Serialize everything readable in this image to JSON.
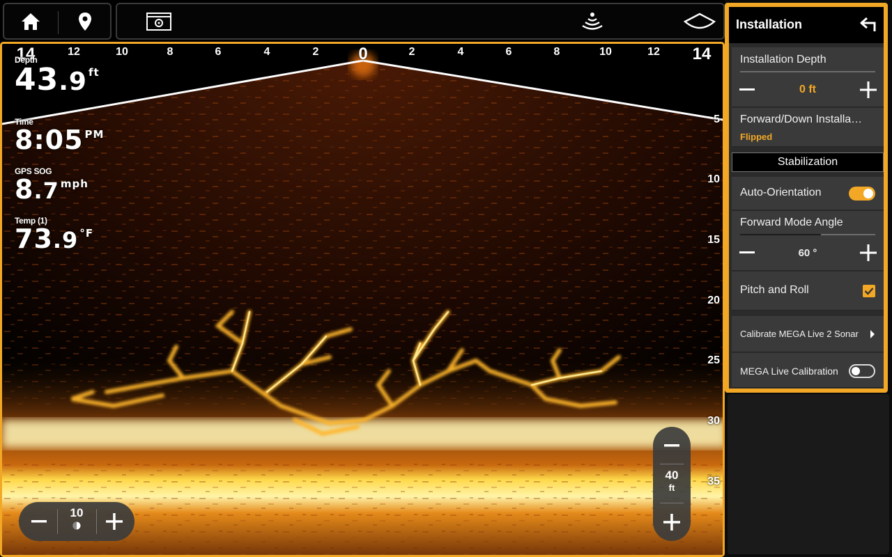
{
  "colors": {
    "accent": "#f2a825",
    "panel": "#3a3a3a",
    "sonar_hot": "#ffcc33"
  },
  "topbar": {
    "home_icon": "home-icon",
    "waypoint_icon": "map-pin-icon",
    "settings_icon": "settings-screen-icon",
    "sonar_icon": "sonar-ping-icon",
    "view_icon": "cone-view-icon"
  },
  "sonar": {
    "range_top": [
      "14",
      "12",
      "10",
      "8",
      "6",
      "4",
      "2",
      "0",
      "2",
      "4",
      "6",
      "8",
      "10",
      "12",
      "14"
    ],
    "depth_right": [
      "5",
      "10",
      "15",
      "20",
      "25",
      "30",
      "35"
    ],
    "readouts": {
      "depth": {
        "label": "Depth",
        "int": "43",
        "dec": ".9",
        "unit": "ft"
      },
      "time": {
        "label": "Time",
        "value": "8:05",
        "unit": "PM"
      },
      "sog": {
        "label": "GPS SOG",
        "int": "8",
        "dec": ".7",
        "unit": "mph"
      },
      "temp": {
        "label": "Temp (1)",
        "int": "73",
        "dec": ".9",
        "unit": "°F"
      }
    },
    "gain": {
      "value": "10"
    },
    "range": {
      "value": "40",
      "unit": "ft"
    }
  },
  "panel": {
    "title": "Installation",
    "installation_depth": {
      "label": "Installation  Depth",
      "value": "0 ft"
    },
    "forward_down": {
      "label": "Forward/Down Installa…",
      "value": "Flipped"
    },
    "stabilization_label": "Stabilization",
    "auto_orientation": {
      "label": "Auto-Orientation",
      "on": true
    },
    "forward_mode_angle": {
      "label": "Forward Mode Angle",
      "value": "60 °",
      "level": 0.6
    },
    "pitch_roll": {
      "label": "Pitch and Roll",
      "checked": true
    },
    "calibrate": {
      "label": "Calibrate MEGA Live 2 Sonar"
    },
    "mega_live_calibration": {
      "label": "MEGA Live Calibration",
      "on": false
    }
  }
}
